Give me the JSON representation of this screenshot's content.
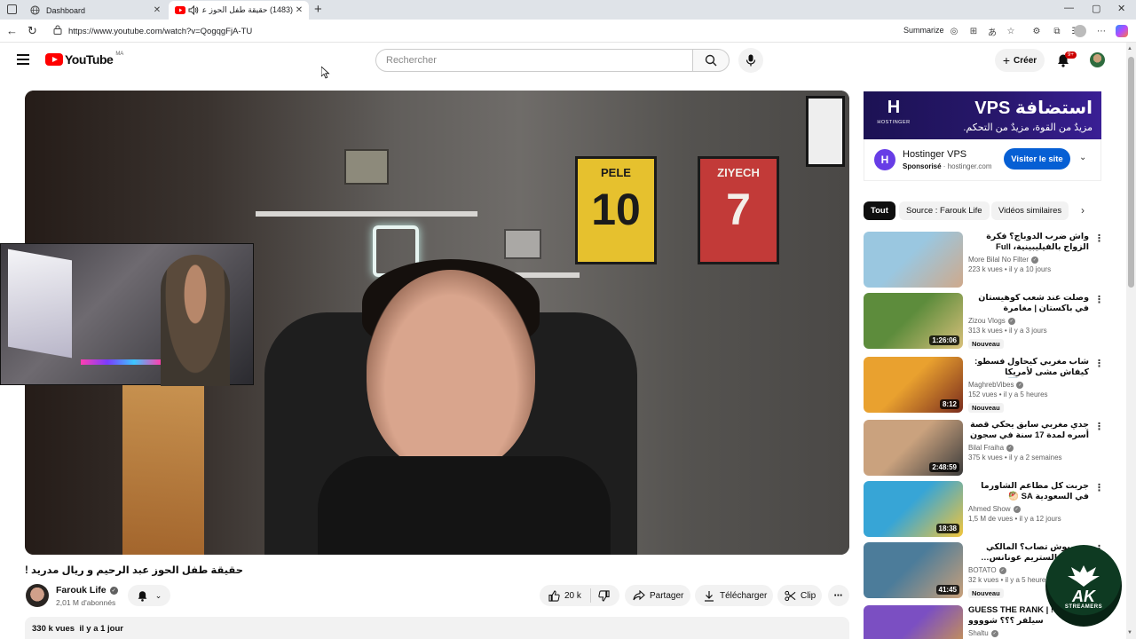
{
  "browser": {
    "tabs": [
      {
        "title": "Dashboard",
        "active": false,
        "icon": "globe-icon"
      },
      {
        "title": "(1483) حقيقة طفل الحوز عبد …",
        "active": true,
        "icon": "youtube-icon",
        "audio": true
      }
    ],
    "url": "https://www.youtube.com/watch?v=QogqgFjA-TU",
    "summarize_label": "Summarize"
  },
  "header": {
    "logo_text": "YouTube",
    "country_code": "MA",
    "search_placeholder": "Rechercher",
    "create_label": "Créer",
    "notification_count": "9+"
  },
  "video": {
    "title": "حقيقة طفل الحوز عبد الرحيم و ريال مدريد !",
    "jersey_left_name": "PELE",
    "jersey_left_number": "10",
    "jersey_right_name": "ZIYECH",
    "jersey_right_number": "7",
    "channel": "Farouk Life",
    "subscribers": "2,01 M d'abonnés",
    "likes": "20 k",
    "share_label": "Partager",
    "download_label": "Télécharger",
    "clip_label": "Clip",
    "views": "330 k vues",
    "age": "il y a 1 jour"
  },
  "ad": {
    "brand": "HOSTINGER",
    "headline": "استضافة VPS",
    "tagline": "مزيدٌ من القوة، مزيدٌ من التحكم.",
    "title": "Hostinger VPS",
    "sponsored": "Sponsorisé",
    "domain": "hostinger.com",
    "cta": "Visiter le site"
  },
  "chips": [
    "Tout",
    "Source : Farouk Life",
    "Vidéos similaires"
  ],
  "recommendations": [
    {
      "title": "واش ضرب الدوباج؟ فكرة الزواج بالفيليبينية، Full stream - Omar | …ياه الليل فاتيلك",
      "channel": "More Bilal No Filter",
      "views": "223 k vues",
      "age": "il y a 10 jours",
      "duration": "",
      "new": "",
      "thumb": [
        "#9ac7e0",
        "#cfa98b"
      ]
    },
    {
      "title": "وصلت عند شعب كوهيستان في باكستان | مغامرة خطيرة…",
      "channel": "Zizou Vlogs",
      "views": "313 k vues",
      "age": "il y a 3 jours",
      "duration": "1:26:06",
      "new": "Nouveau",
      "thumb": [
        "#5d8c3c",
        "#d8c07a"
      ]
    },
    {
      "title": "شاب مغربي كيحاول فسطو: كيفاش مشى لأمريكا MA➡️US soufiane jeddi",
      "channel": "MaghrebVibes",
      "views": "152 vues",
      "age": "il y a 5 heures",
      "duration": "8:12",
      "new": "Nouveau",
      "thumb": [
        "#e9a12f",
        "#7a2c1d"
      ]
    },
    {
      "title": "جدي مغربي سابق يحكي قصة أسره لمدة 17 سنة في سجون البوليساريو | … Dekka",
      "channel": "Bilal Fraiha",
      "views": "375 k vues",
      "age": "il y a 2 semaines",
      "duration": "2:48:59",
      "new": "",
      "thumb": [
        "#caa27e",
        "#3b3b3b"
      ]
    },
    {
      "title": "جربت كل مطاعم الشاورما في السعودية SA 🥙",
      "channel": "Ahmed Show",
      "views": "1,5 M de vues",
      "age": "il y a 12 jours",
      "duration": "18:38",
      "new": "",
      "thumb": [
        "#37a5d6",
        "#f2c53b"
      ]
    },
    {
      "title": "…بيبيوش تصاب؟ المالكي سيتي فالستريم عونانس…",
      "channel": "BOTATO",
      "views": "32 k vues",
      "age": "il y a 5 heures",
      "duration": "41:45",
      "new": "Nouveau",
      "thumb": [
        "#4c7c9a",
        "#c9a07a"
      ]
    },
    {
      "title": "GUESS THE RANK | ! والكه سيلفر ؟؟؟ شوووو",
      "channel": "Shaltu",
      "views": "",
      "age": "",
      "duration": "",
      "new": "",
      "thumb": [
        "#7b4fc2",
        "#d8a23c"
      ]
    }
  ],
  "overlay_badge": {
    "main": "AK",
    "sub": "STREAMERS"
  },
  "colors": {
    "youtube_red": "#ff0000",
    "cta_blue": "#065fd4",
    "chip_active": "#0f0f0f",
    "ad_purple": "#27176b"
  }
}
